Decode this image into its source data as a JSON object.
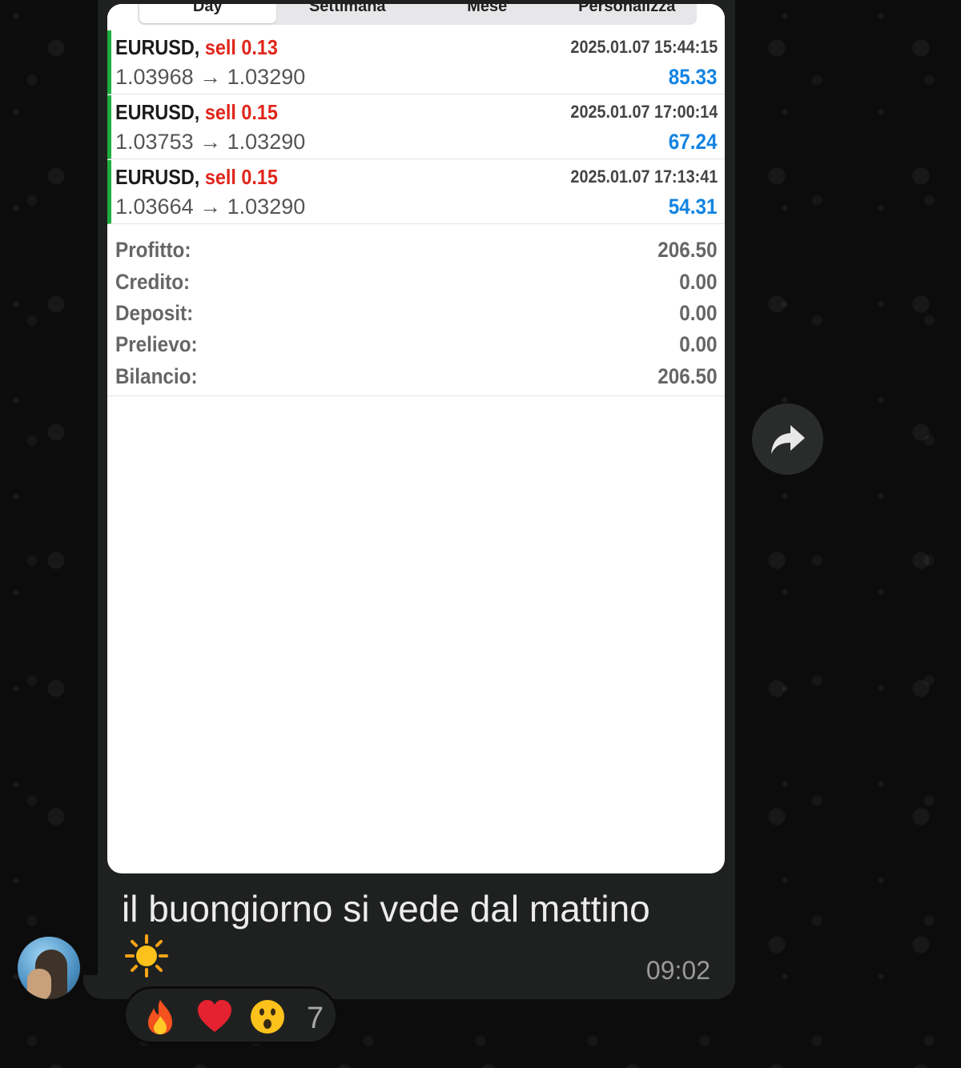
{
  "app": {
    "tabs": [
      {
        "label": "Day"
      },
      {
        "label": "Settimana"
      },
      {
        "label": "Mese"
      },
      {
        "label": "Personalizza"
      }
    ]
  },
  "trades": [
    {
      "symbol": "EURUSD,",
      "side": "sell 0.13",
      "time": "2025.01.07 15:44:15",
      "open": "1.03968",
      "arrow": "→",
      "close": "1.03290",
      "profit": "85.33"
    },
    {
      "symbol": "EURUSD,",
      "side": "sell 0.15",
      "time": "2025.01.07 17:00:14",
      "open": "1.03753",
      "arrow": "→",
      "close": "1.03290",
      "profit": "67.24"
    },
    {
      "symbol": "EURUSD,",
      "side": "sell 0.15",
      "time": "2025.01.07 17:13:41",
      "open": "1.03664",
      "arrow": "→",
      "close": "1.03290",
      "profit": "54.31"
    }
  ],
  "summary": [
    {
      "label": "Profitto:",
      "value": "206.50"
    },
    {
      "label": "Credito:",
      "value": "0.00"
    },
    {
      "label": "Deposit:",
      "value": "0.00"
    },
    {
      "label": "Prelievo:",
      "value": "0.00"
    },
    {
      "label": "Bilancio:",
      "value": "206.50"
    }
  ],
  "message": {
    "text": "il buongiorno si vede dal mattino",
    "emoji": "sun-emoji",
    "time": "09:02"
  },
  "reactions": {
    "emojis": [
      "fire-emoji",
      "red-heart-emoji",
      "surprised-face-emoji"
    ],
    "count": "7"
  },
  "colors": {
    "sell": "#e0251b",
    "profit": "#1384e3",
    "trade_bar": "#1fae3f",
    "bubble": "#1f2120"
  }
}
